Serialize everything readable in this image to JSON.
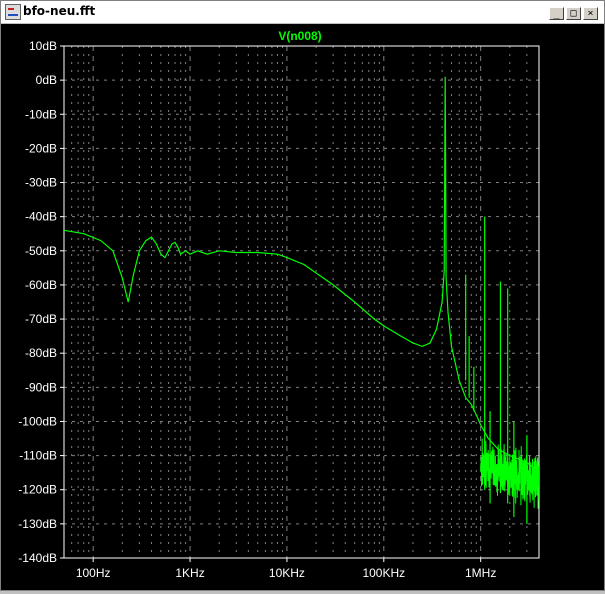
{
  "window": {
    "title": "bfo-neu.fft",
    "buttons": {
      "minimize": "_",
      "maximize": "□",
      "close": "×"
    }
  },
  "colors": {
    "background": "#000000",
    "trace": "#00ff00",
    "grid": "#808080",
    "text": "#ffffff",
    "trace_label": "#00ff00"
  },
  "chart_data": {
    "type": "line",
    "title": "V(n008)",
    "xscale": "log",
    "xlim": [
      50,
      4000000
    ],
    "ylim": [
      -140,
      10
    ],
    "xlabel": "",
    "ylabel": "",
    "grid": true,
    "y_ticks": [
      {
        "v": 10,
        "label": "10dB"
      },
      {
        "v": 0,
        "label": "0dB"
      },
      {
        "v": -10,
        "label": "-10dB"
      },
      {
        "v": -20,
        "label": "-20dB"
      },
      {
        "v": -30,
        "label": "-30dB"
      },
      {
        "v": -40,
        "label": "-40dB"
      },
      {
        "v": -50,
        "label": "-50dB"
      },
      {
        "v": -60,
        "label": "-60dB"
      },
      {
        "v": -70,
        "label": "-70dB"
      },
      {
        "v": -80,
        "label": "-80dB"
      },
      {
        "v": -90,
        "label": "-90dB"
      },
      {
        "v": -100,
        "label": "-100dB"
      },
      {
        "v": -110,
        "label": "-110dB"
      },
      {
        "v": -120,
        "label": "-120dB"
      },
      {
        "v": -130,
        "label": "-130dB"
      },
      {
        "v": -140,
        "label": "-140dB"
      }
    ],
    "x_ticks": [
      {
        "v": 100,
        "label": "100Hz"
      },
      {
        "v": 1000,
        "label": "1KHz"
      },
      {
        "v": 10000,
        "label": "10KHz"
      },
      {
        "v": 100000,
        "label": "100KHz"
      },
      {
        "v": 1000000,
        "label": "1MHz"
      }
    ],
    "series": [
      {
        "name": "V(n008)",
        "points": [
          [
            50,
            -44
          ],
          [
            80,
            -45
          ],
          [
            120,
            -47
          ],
          [
            160,
            -50
          ],
          [
            200,
            -58
          ],
          [
            230,
            -65
          ],
          [
            260,
            -57
          ],
          [
            300,
            -50
          ],
          [
            350,
            -47
          ],
          [
            400,
            -46
          ],
          [
            450,
            -48
          ],
          [
            500,
            -51
          ],
          [
            550,
            -52
          ],
          [
            600,
            -50
          ],
          [
            650,
            -48
          ],
          [
            700,
            -47.5
          ],
          [
            750,
            -49
          ],
          [
            800,
            -51
          ],
          [
            900,
            -50
          ],
          [
            1000,
            -51
          ],
          [
            1200,
            -50
          ],
          [
            1500,
            -51
          ],
          [
            2000,
            -50
          ],
          [
            3000,
            -50.5
          ],
          [
            5000,
            -50.5
          ],
          [
            8000,
            -51
          ],
          [
            10000,
            -52
          ],
          [
            15000,
            -54
          ],
          [
            20000,
            -56.5
          ],
          [
            30000,
            -60
          ],
          [
            50000,
            -65
          ],
          [
            80000,
            -70
          ],
          [
            100000,
            -72
          ],
          [
            150000,
            -75
          ],
          [
            200000,
            -77
          ],
          [
            250000,
            -78
          ],
          [
            300000,
            -77
          ],
          [
            350000,
            -73
          ],
          [
            400000,
            -65
          ],
          [
            420000,
            -56
          ],
          [
            430000,
            1
          ],
          [
            440000,
            -58
          ],
          [
            460000,
            -68
          ],
          [
            500000,
            -78
          ],
          [
            600000,
            -88
          ],
          [
            700000,
            -93
          ],
          [
            800000,
            -95
          ],
          [
            900000,
            -98
          ],
          [
            1000000,
            -101
          ],
          [
            1200000,
            -105
          ],
          [
            1500000,
            -108
          ],
          [
            2000000,
            -110
          ],
          [
            3000000,
            -112
          ],
          [
            4000000,
            -115
          ]
        ],
        "spurs": [
          {
            "x": 700000,
            "top": -57,
            "base": -88
          },
          {
            "x": 760000,
            "top": -75,
            "base": -93
          },
          {
            "x": 850000,
            "top": -84,
            "base": -97
          },
          {
            "x": 1100000,
            "top": -40,
            "base": -120
          },
          {
            "x": 1250000,
            "top": -97,
            "base": -124
          },
          {
            "x": 1600000,
            "top": -59,
            "base": -121
          },
          {
            "x": 1900000,
            "top": -61,
            "base": -124
          },
          {
            "x": 2200000,
            "top": -100,
            "base": -128
          },
          {
            "x": 3000000,
            "top": -104,
            "base": -130
          }
        ],
        "noise_floor": {
          "from": 1000000,
          "to": 4000000,
          "center": -113,
          "spread": 6
        }
      }
    ]
  }
}
